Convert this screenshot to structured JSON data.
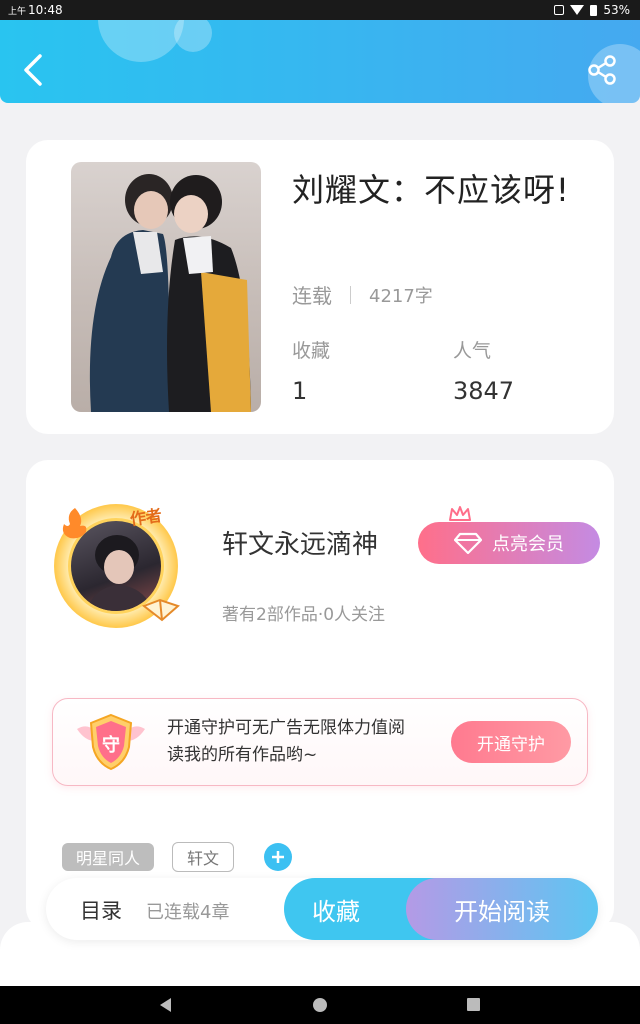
{
  "status_bar": {
    "ampm": "上午",
    "time": "10:48",
    "battery": "53%"
  },
  "header": {
    "back_icon": "chevron-left-icon",
    "share_icon": "share-icon"
  },
  "book": {
    "title": "刘耀文：不应该呀!",
    "status": "连载",
    "word_count": "4217字",
    "favorites_label": "收藏",
    "favorites_value": "1",
    "popularity_label": "人气",
    "popularity_value": "3847"
  },
  "author": {
    "badge": "作者",
    "name": "轩文永远滴神",
    "meta": "著有2部作品·0人关注",
    "vip_button": "点亮会员"
  },
  "guard": {
    "icon_text": "守",
    "text": "开通守护可无广告无限体力值阅读我的所有作品哟~",
    "button": "开通守护"
  },
  "tags": [
    "明星同人",
    "轩文"
  ],
  "action_bar": {
    "toc": "目录",
    "toc_status": "已连载4章",
    "favorite": "收藏",
    "start_reading": "开始阅读"
  },
  "colors": {
    "header_start": "#29c4f0",
    "header_end": "#45a9f0",
    "accent_blue": "#3fc6f0",
    "vip_pink": "#ff6f8a",
    "vip_purple": "#c48be3"
  }
}
